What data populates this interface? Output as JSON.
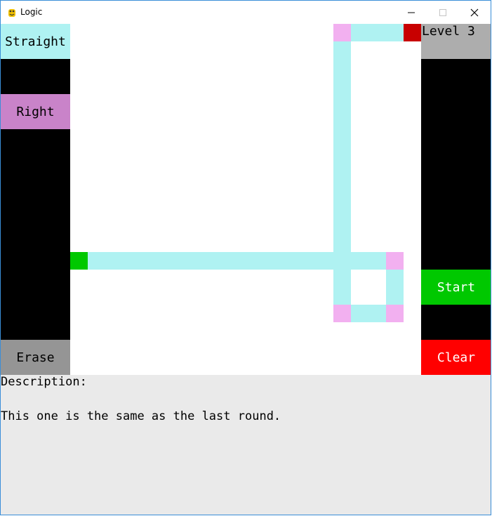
{
  "window": {
    "title": "Logic",
    "icon": "pygame-snake-icon",
    "controls": {
      "minimize": "minimize-icon",
      "maximize": "maximize-icon",
      "close": "close-icon"
    }
  },
  "left_panel": {
    "straight_label": "Straight",
    "right_label": "Right",
    "erase_label": "Erase"
  },
  "right_panel": {
    "level_label": "Level 3",
    "start_label": "Start",
    "clear_label": "Clear"
  },
  "description": {
    "heading": "Description:",
    "text": "This one is the same as the last round."
  },
  "colors": {
    "straight_piece": "#aff2f2",
    "turn_piece": "#f2b0f0",
    "right_button": "#c983c9",
    "start_point": "#00c800",
    "end_point": "#c80000",
    "start_button": "#00c800",
    "clear_button": "#ff0000",
    "erase_button": "#959595",
    "level_box": "#adadad",
    "panel_background": "#000000",
    "description_background": "#eaeaea"
  }
}
